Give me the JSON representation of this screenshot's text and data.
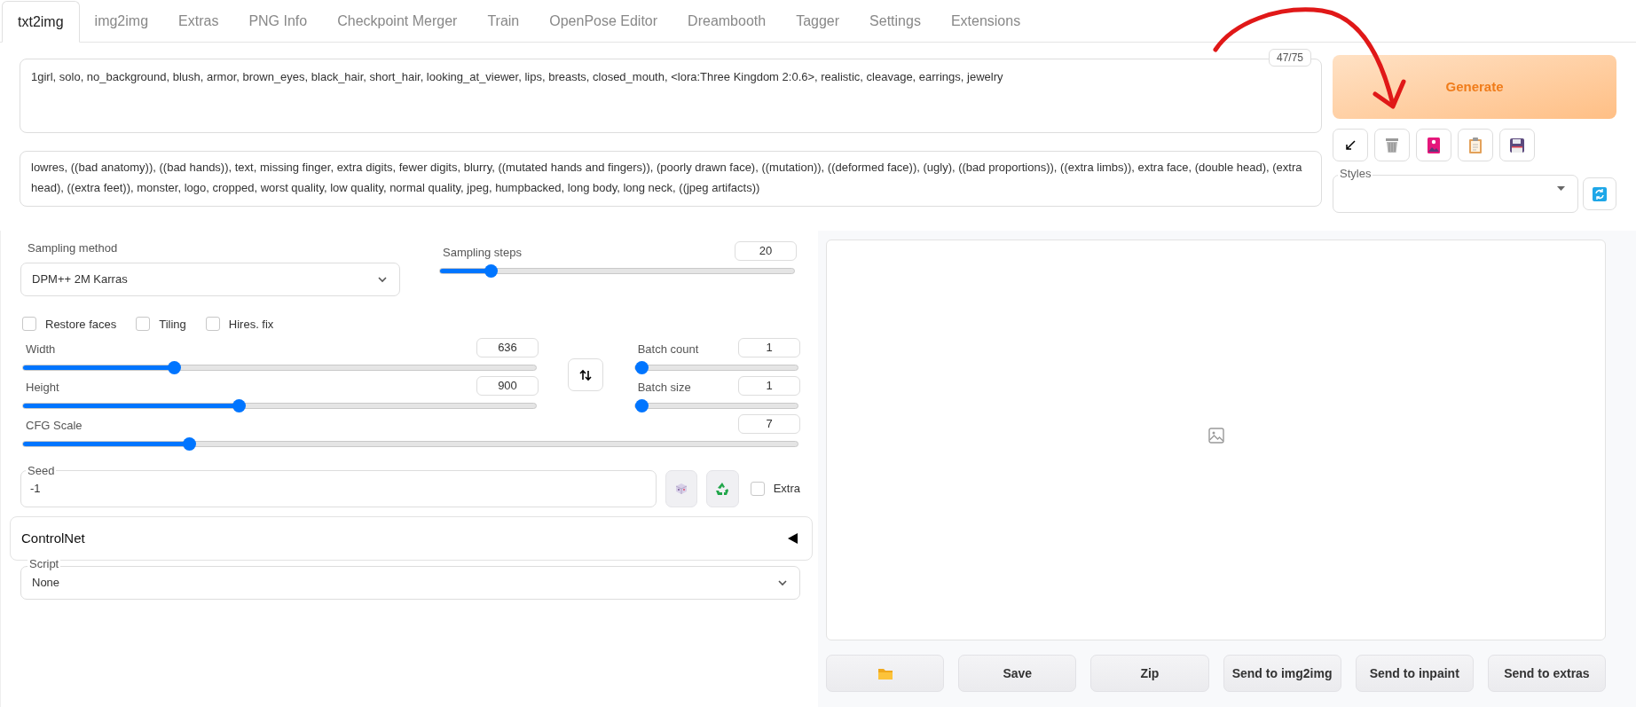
{
  "tabs": [
    {
      "label": "txt2img",
      "selected": true
    },
    {
      "label": "img2img",
      "selected": false
    },
    {
      "label": "Extras",
      "selected": false
    },
    {
      "label": "PNG Info",
      "selected": false
    },
    {
      "label": "Checkpoint Merger",
      "selected": false
    },
    {
      "label": "Train",
      "selected": false
    },
    {
      "label": "OpenPose Editor",
      "selected": false
    },
    {
      "label": "Dreambooth",
      "selected": false
    },
    {
      "label": "Tagger",
      "selected": false
    },
    {
      "label": "Settings",
      "selected": false
    },
    {
      "label": "Extensions",
      "selected": false
    }
  ],
  "prompt": {
    "value": "1girl, solo, no_background, blush, armor, brown_eyes, black_hair, short_hair, looking_at_viewer, lips, breasts, closed_mouth, <lora:Three Kingdom 2:0.6>, realistic, cleavage, earrings, jewelry",
    "token_count": "47/75"
  },
  "negative_prompt": {
    "value": "lowres, ((bad anatomy)), ((bad hands)), text, missing finger, extra digits, fewer digits, blurry, ((mutated hands and fingers)), (poorly drawn face), ((mutation)), ((deformed face)), (ugly), ((bad proportions)), ((extra limbs)), extra face, (double head), (extra head), ((extra feet)), monster, logo, cropped, worst quality, low quality, normal quality, jpeg, humpbacked, long body, long neck, ((jpeg artifacts))"
  },
  "generate_button": "Generate",
  "styles": {
    "label": "Styles"
  },
  "sampling_method": {
    "label": "Sampling method",
    "value": "DPM++ 2M Karras"
  },
  "sampling_steps": {
    "label": "Sampling steps",
    "value": "20",
    "level": 0.13
  },
  "checkboxes": [
    {
      "label": "Restore faces",
      "checked": false
    },
    {
      "label": "Tiling",
      "checked": false
    },
    {
      "label": "Hires. fix",
      "checked": false
    }
  ],
  "width": {
    "label": "Width",
    "value": "636",
    "level": 0.29
  },
  "height": {
    "label": "Height",
    "value": "900",
    "level": 0.42
  },
  "batch_count": {
    "label": "Batch count",
    "value": "1",
    "level": 0
  },
  "batch_size": {
    "label": "Batch size",
    "value": "1",
    "level": 0
  },
  "cfg_scale": {
    "label": "CFG Scale",
    "value": "7",
    "level": 0.21
  },
  "seed": {
    "label": "Seed",
    "value": "-1"
  },
  "extra": {
    "label": "Extra",
    "checked": false
  },
  "controlnet": {
    "title": "ControlNet",
    "expanded": false
  },
  "script": {
    "label": "Script",
    "value": "None"
  },
  "output_buttons": [
    {
      "kind": "folder"
    },
    {
      "kind": "text",
      "label": "Save"
    },
    {
      "kind": "text",
      "label": "Zip"
    },
    {
      "kind": "text",
      "label": "Send to img2img"
    },
    {
      "kind": "text",
      "label": "Send to inpaint"
    },
    {
      "kind": "text",
      "label": "Send to extras"
    }
  ]
}
